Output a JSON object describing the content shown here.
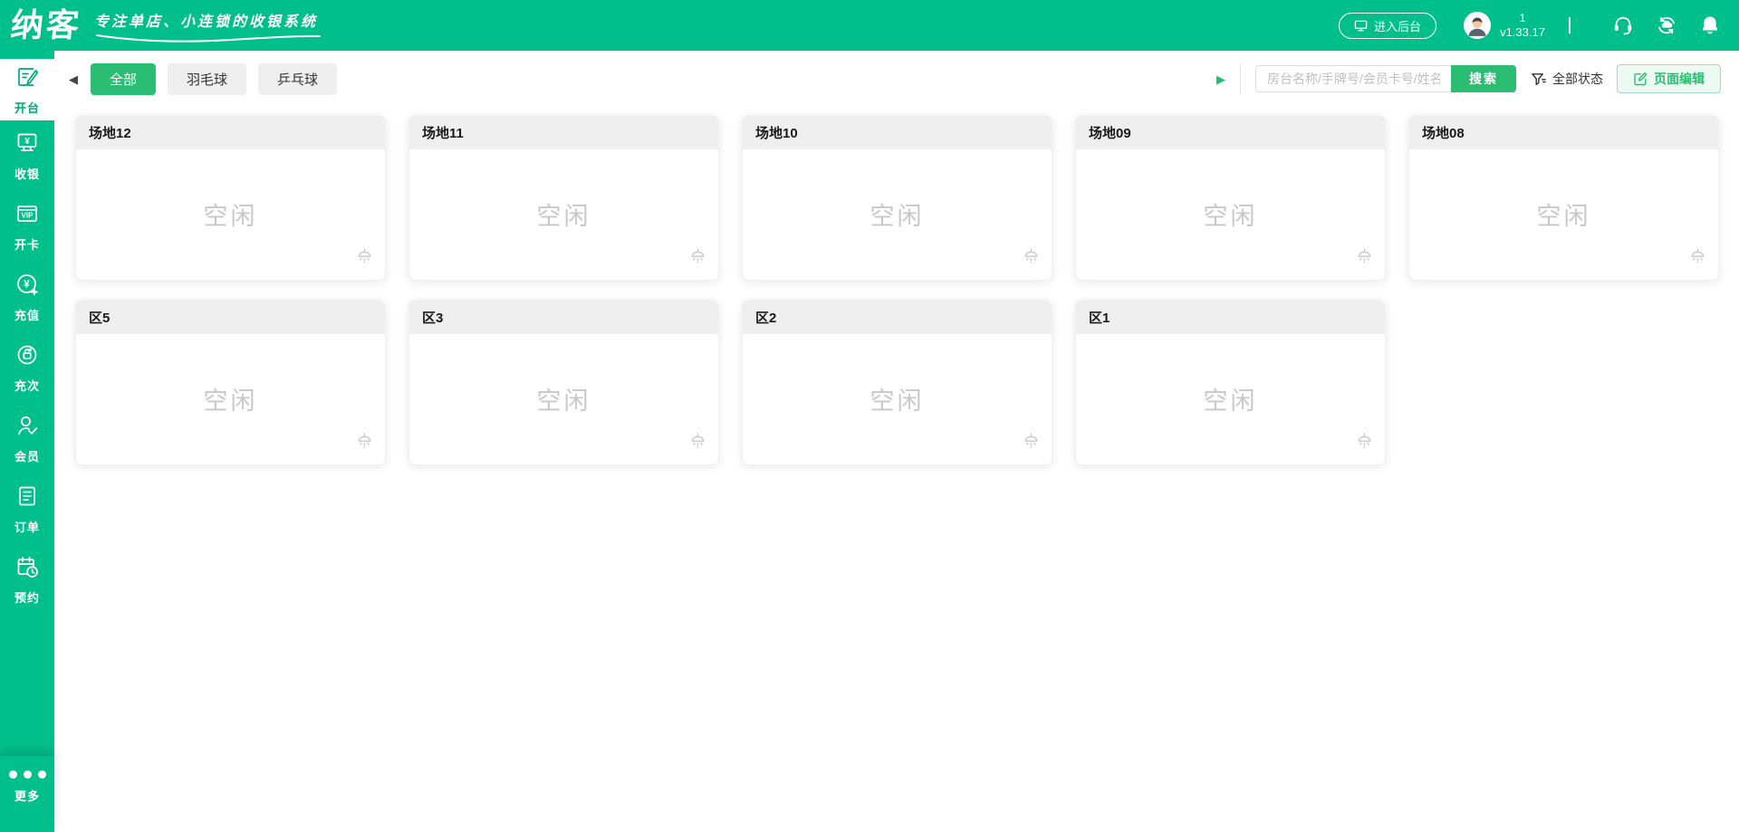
{
  "header": {
    "logo": "纳客",
    "tagline": "专注单店、小连锁的收银系统",
    "enter_backend_label": "进入后台",
    "store_name": "1",
    "version": "v1.33.17"
  },
  "sidebar": {
    "items": [
      {
        "label": "开台",
        "icon": "open-table-icon",
        "active": true
      },
      {
        "label": "收银",
        "icon": "cashier-icon",
        "active": false
      },
      {
        "label": "开卡",
        "icon": "vip-card-icon",
        "active": false
      },
      {
        "label": "充值",
        "icon": "recharge-icon",
        "active": false
      },
      {
        "label": "充次",
        "icon": "recharge-times-icon",
        "active": false
      },
      {
        "label": "会员",
        "icon": "member-icon",
        "active": false
      },
      {
        "label": "订单",
        "icon": "order-icon",
        "active": false
      },
      {
        "label": "预约",
        "icon": "booking-icon",
        "active": false
      }
    ],
    "more_label": "更多"
  },
  "toolbar": {
    "tabs": [
      {
        "label": "全部",
        "active": true
      },
      {
        "label": "羽毛球",
        "active": false
      },
      {
        "label": "乒乓球",
        "active": false
      }
    ],
    "search_placeholder": "房台名称/手牌号/会员卡号/姓名",
    "search_button_label": "搜索",
    "status_filter_label": "全部状态",
    "page_edit_label": "页面编辑"
  },
  "venues": {
    "cards": [
      {
        "name": "场地12",
        "status": "空闲"
      },
      {
        "name": "场地11",
        "status": "空闲"
      },
      {
        "name": "场地10",
        "status": "空闲"
      },
      {
        "name": "场地09",
        "status": "空闲"
      },
      {
        "name": "场地08",
        "status": "空闲"
      },
      {
        "name": "区5",
        "status": "空闲"
      },
      {
        "name": "区3",
        "status": "空闲"
      },
      {
        "name": "区2",
        "status": "空闲"
      },
      {
        "name": "区1",
        "status": "空闲"
      }
    ]
  },
  "colors": {
    "brand_green": "#00BF8A",
    "button_green": "#2BBD72",
    "card_header_gray": "#EFEFEF",
    "idle_text_gray": "#C8C8C8",
    "page_edit_bg": "#ECFAF3"
  }
}
